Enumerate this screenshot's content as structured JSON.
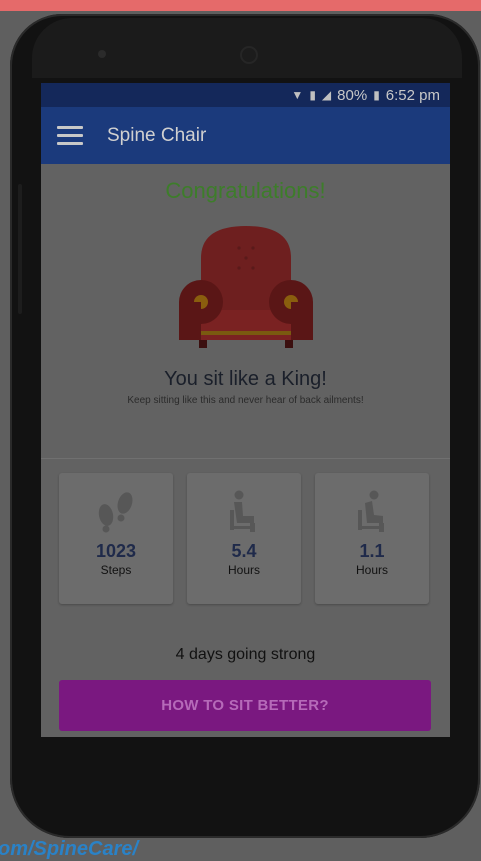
{
  "status_bar": {
    "battery": "80%",
    "time": "6:52 pm"
  },
  "app_bar": {
    "title": "Spine Chair"
  },
  "result": {
    "title": "Congratulations!",
    "headline": "You sit like a King!",
    "subline": "Keep sitting like this and never hear of back ailments!"
  },
  "stats": [
    {
      "icon": "footprints-icon",
      "value": "1023",
      "unit": "Steps"
    },
    {
      "icon": "sitting-person-icon",
      "value": "5.4",
      "unit": "Hours"
    },
    {
      "icon": "slouching-person-icon",
      "value": "1.1",
      "unit": "Hours"
    }
  ],
  "streak_text": "4 days going strong",
  "cta_label": "HOW TO SIT BETTER?",
  "caption": "om/SpineCare/",
  "colors": {
    "app_bar": "#1b3a7c",
    "status_bar": "#14285a",
    "success_green": "#3d7d2a",
    "cta_purple": "#7a1880",
    "chair_red": "#6e1f1f"
  }
}
